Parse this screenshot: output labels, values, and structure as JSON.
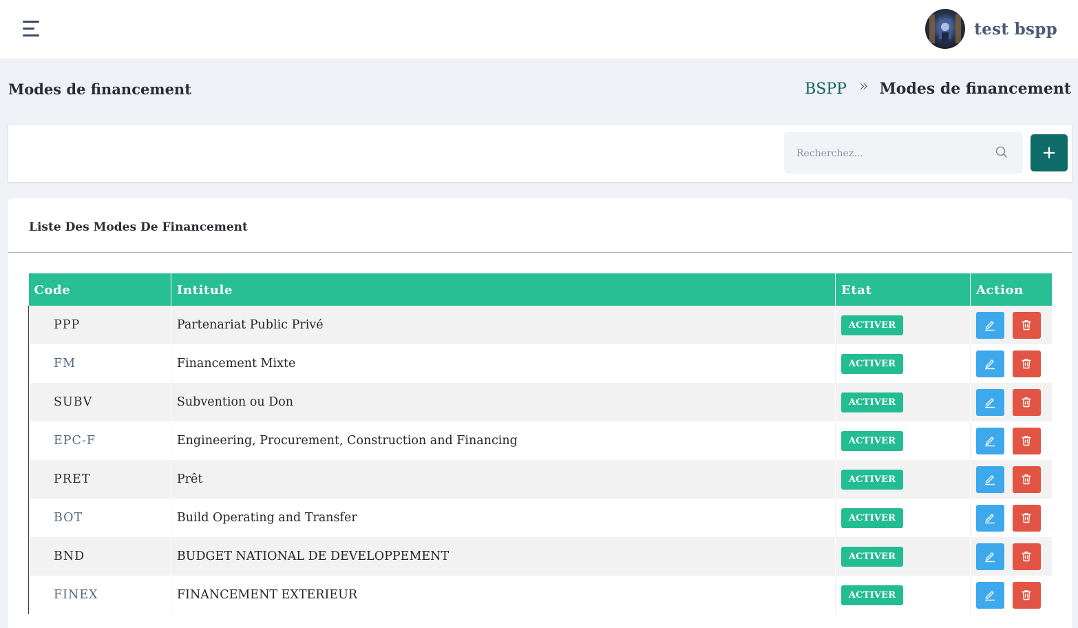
{
  "header": {
    "username": "test bspp"
  },
  "page": {
    "title": "Modes de financement"
  },
  "breadcrumb": {
    "root": "BSPP",
    "separator": "»",
    "current": "Modes de financement"
  },
  "toolbar": {
    "search_placeholder": "Recherchez...",
    "add_label": "+"
  },
  "list": {
    "title": "Liste Des Modes De Financement",
    "columns": {
      "code": "Code",
      "intitule": "Intitule",
      "etat": "Etat",
      "action": "Action"
    },
    "rows": [
      {
        "code": "PPP",
        "intitule": "Partenariat Public Privé",
        "etat": "ACTIVER"
      },
      {
        "code": "FM",
        "intitule": "Financement Mixte",
        "etat": "ACTIVER"
      },
      {
        "code": "SUBV",
        "intitule": "Subvention ou Don",
        "etat": "ACTIVER"
      },
      {
        "code": "EPC-F",
        "intitule": "Engineering, Procurement, Construction and Financing",
        "etat": "ACTIVER"
      },
      {
        "code": "PRET",
        "intitule": "Prêt",
        "etat": "ACTIVER"
      },
      {
        "code": "BOT",
        "intitule": "Build Operating and Transfer",
        "etat": "ACTIVER"
      },
      {
        "code": "BND",
        "intitule": "BUDGET NATIONAL DE DEVELOPPEMENT",
        "etat": "ACTIVER"
      },
      {
        "code": "FINEX",
        "intitule": "FINANCEMENT EXTERIEUR",
        "etat": "ACTIVER"
      }
    ]
  },
  "icons": {
    "menu": "hamburger-menu-icon",
    "search": "search-icon",
    "edit": "edit-pencil-icon",
    "delete": "trash-icon"
  },
  "colors": {
    "accent": "#0e6b67",
    "table_header": "#27bf93",
    "badge": "#24bc92",
    "edit_button": "#3da9ec",
    "delete_button": "#e25544"
  }
}
